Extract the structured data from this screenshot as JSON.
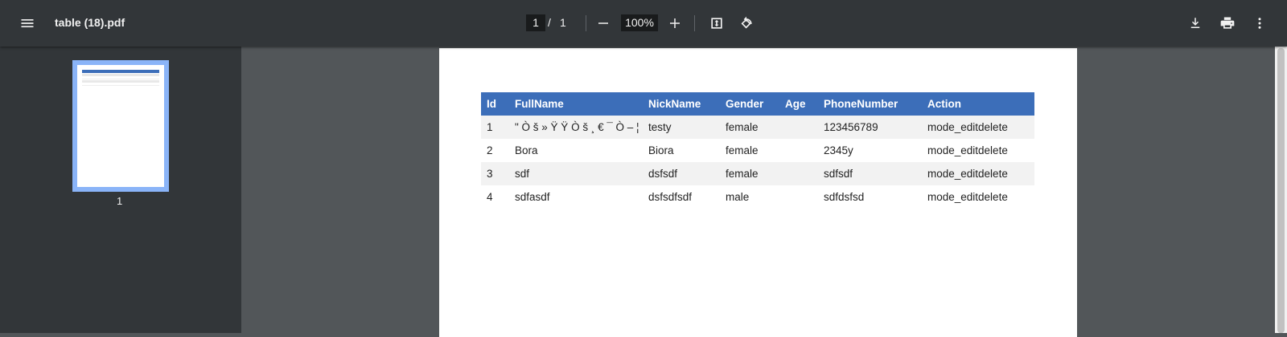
{
  "toolbar": {
    "title": "table (18).pdf",
    "current_page": "1",
    "page_separator": "/",
    "total_pages": "1",
    "zoom": "100%"
  },
  "sidebar": {
    "thumbnail_label": "1"
  },
  "table": {
    "headers": [
      "Id",
      "FullName",
      "NickName",
      "Gender",
      "Age",
      "PhoneNumber",
      "Action"
    ],
    "rows": [
      {
        "id": "1",
        "fullname": " \" Ò š » Ÿ Ÿ Ò š ¸ € ¯ Ò – ¦",
        "nickname": "testy",
        "gender": "female",
        "age": "",
        "phone": "123456789",
        "action": "mode_editdelete"
      },
      {
        "id": "2",
        "fullname": "Bora",
        "nickname": "Biora",
        "gender": "female",
        "age": "",
        "phone": "2345y",
        "action": "mode_editdelete"
      },
      {
        "id": "3",
        "fullname": "sdf",
        "nickname": "dsfsdf",
        "gender": "female",
        "age": "",
        "phone": "sdfsdf",
        "action": "mode_editdelete"
      },
      {
        "id": "4",
        "fullname": "sdfasdf",
        "nickname": "dsfsdfsdf",
        "gender": "male",
        "age": "",
        "phone": "sdfdsfsd",
        "action": "mode_editdelete"
      }
    ]
  },
  "icons": {
    "menu": "menu-icon",
    "zoom_out": "minus-icon",
    "zoom_in": "plus-icon",
    "fit": "fit-to-page-icon",
    "rotate": "rotate-icon",
    "download": "download-icon",
    "print": "print-icon",
    "more": "more-vert-icon"
  },
  "colors": {
    "toolbar_bg": "#323639",
    "viewer_bg": "#525659",
    "table_header": "#3c6eb9",
    "thumb_highlight": "#8ab4f8"
  }
}
